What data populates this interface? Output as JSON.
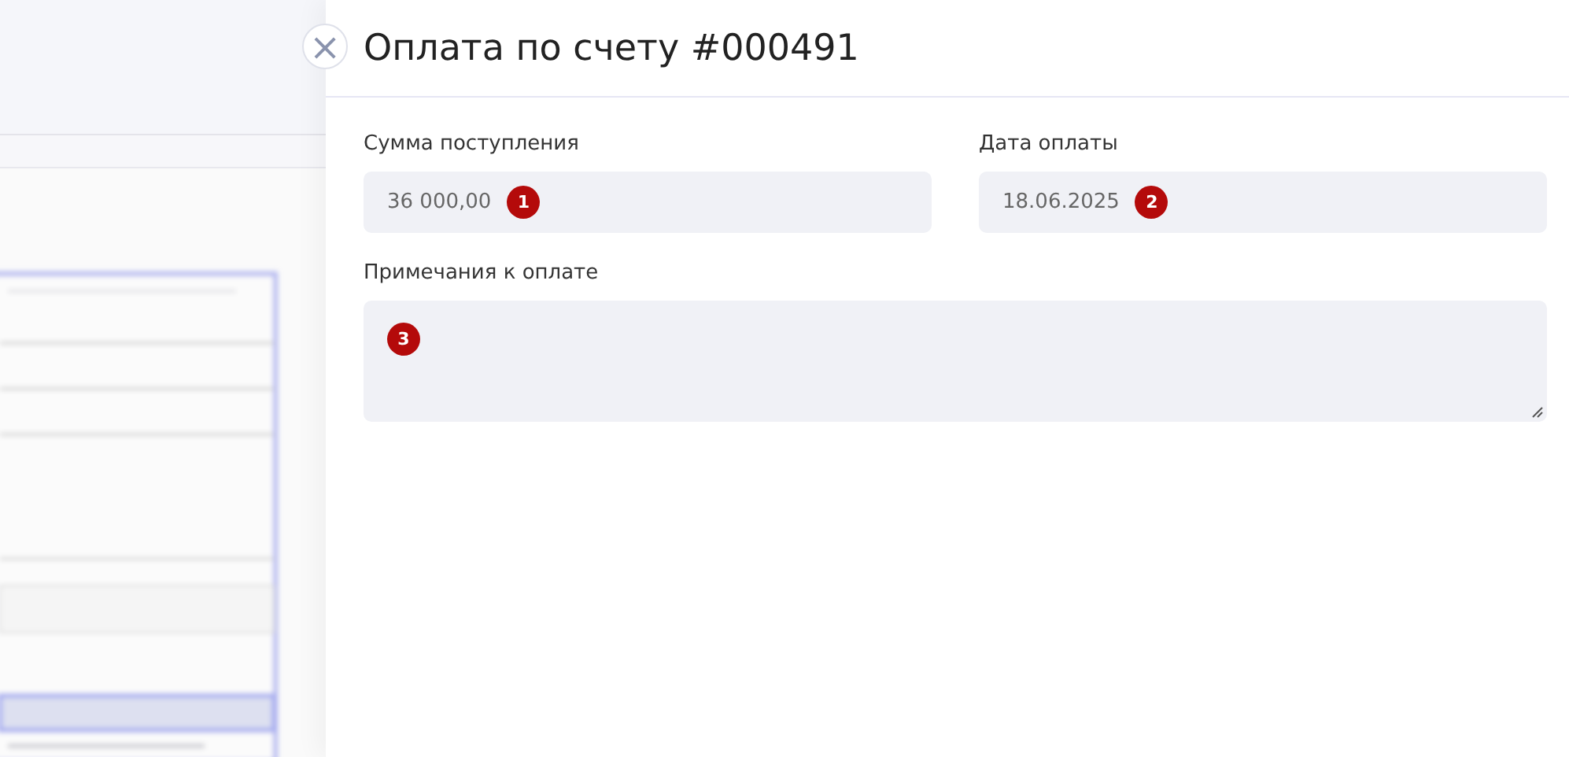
{
  "panel": {
    "title": "Оплата по счету #000491",
    "close_icon": "×"
  },
  "fields": [
    {
      "kind": "input",
      "label": "Сумма поступления",
      "value": "36 000,00",
      "badge": "1"
    },
    {
      "kind": "input",
      "label": "Дата оплаты",
      "value": "18.06.2025",
      "badge": "2"
    },
    {
      "kind": "textarea",
      "label": "Примечания к оплате",
      "badge": "3"
    }
  ]
}
